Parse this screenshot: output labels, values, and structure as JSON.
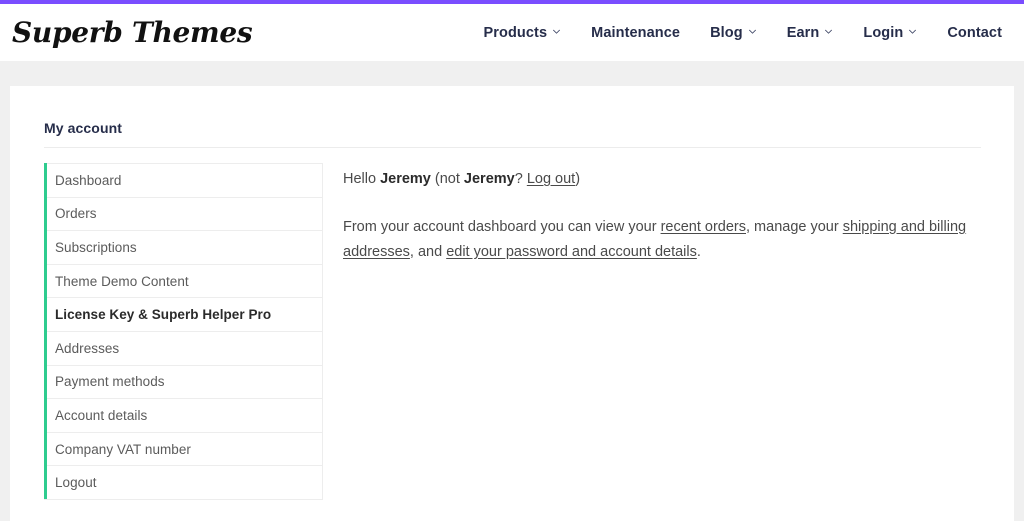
{
  "theme": {
    "accent_top_bar": "#7a4dff",
    "sidebar_accent": "#2ecc8f",
    "nav_text": "#262d4a",
    "page_background": "#f0f0f0",
    "card_background": "#ffffff"
  },
  "header": {
    "logo_text": "Superb Themes",
    "nav": [
      {
        "label": "Products",
        "has_dropdown": true,
        "icon": "chevron-down-icon"
      },
      {
        "label": "Maintenance",
        "has_dropdown": false,
        "icon": ""
      },
      {
        "label": "Blog",
        "has_dropdown": true,
        "icon": "chevron-down-icon"
      },
      {
        "label": "Earn",
        "has_dropdown": true,
        "icon": "chevron-down-icon"
      },
      {
        "label": "Login",
        "has_dropdown": true,
        "icon": "chevron-down-icon"
      },
      {
        "label": "Contact",
        "has_dropdown": false,
        "icon": ""
      }
    ]
  },
  "page": {
    "title": "My account"
  },
  "account_nav": {
    "items": [
      {
        "label": "Dashboard",
        "active": false
      },
      {
        "label": "Orders",
        "active": false
      },
      {
        "label": "Subscriptions",
        "active": false
      },
      {
        "label": "Theme Demo Content",
        "active": false
      },
      {
        "label": "License Key & Superb Helper Pro",
        "active": true
      },
      {
        "label": "Addresses",
        "active": false
      },
      {
        "label": "Payment methods",
        "active": false
      },
      {
        "label": "Account details",
        "active": false
      },
      {
        "label": "Company VAT number",
        "active": false
      },
      {
        "label": "Logout",
        "active": false
      }
    ]
  },
  "account_content": {
    "greeting": {
      "hello_prefix": "Hello ",
      "user_name": "Jeremy",
      "not_prefix": " (not ",
      "not_user_name": "Jeremy",
      "question": "? ",
      "logout_link": "Log out",
      "suffix": ")"
    },
    "dashboard_text": {
      "part1": "From your account dashboard you can view your ",
      "link1": "recent orders",
      "part2": ", manage your ",
      "link2": "shipping and billing addresses",
      "part3": ", and ",
      "link3": "edit your password and account details",
      "part4": "."
    }
  }
}
